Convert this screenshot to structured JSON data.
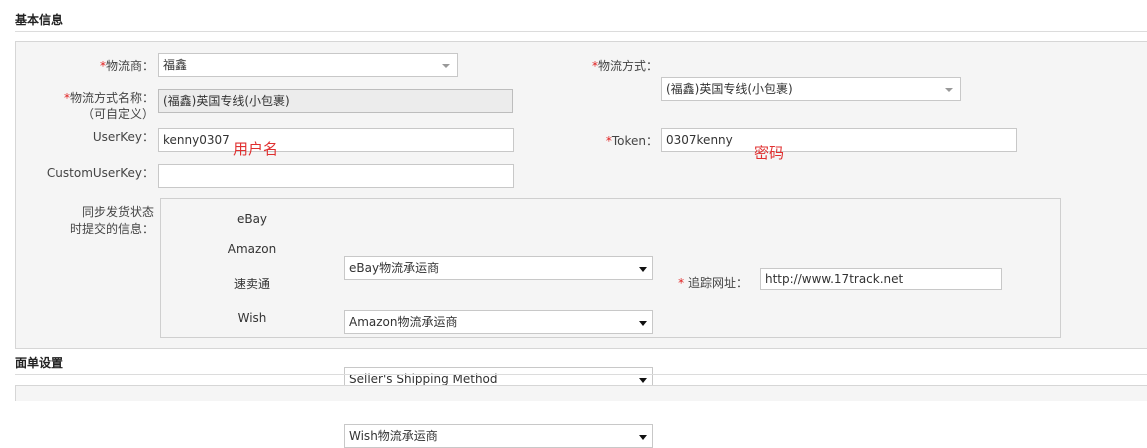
{
  "sections": {
    "basic": {
      "title": "基本信息"
    },
    "label_settings": {
      "title": "面单设置"
    }
  },
  "form": {
    "carrier": {
      "required": "*",
      "label": "物流商：",
      "value": "福鑫"
    },
    "shipping_method": {
      "required": "*",
      "label": "物流方式：",
      "value": "(福鑫)英国专线(小包裹)"
    },
    "method_name": {
      "required": "*",
      "label_line1": "物流方式名称：",
      "label_line2": "（可自定义）",
      "value": "(福鑫)英国专线(小包裹)"
    },
    "userkey": {
      "label": "UserKey：",
      "value": "kenny0307",
      "annotation": "用户名"
    },
    "token": {
      "required": "*",
      "label": "Token：",
      "value": "0307kenny",
      "annotation": "密码"
    },
    "custom_userkey": {
      "label": "CustomUserKey：",
      "value": ""
    }
  },
  "sync": {
    "label_line1": "同步发货状态",
    "label_line2": "时提交的信息：",
    "rows": [
      {
        "platform": "eBay",
        "value": "eBay物流承运商"
      },
      {
        "platform": "Amazon",
        "value": "Amazon物流承运商"
      },
      {
        "platform": "速卖通",
        "value": "Seller's Shipping Method"
      },
      {
        "platform": "Wish",
        "value": "Wish物流承运商"
      }
    ],
    "tracking": {
      "required": "*",
      "label": "追踪网址：",
      "value": "http://www.17track.net"
    }
  },
  "colors": {
    "required": "#e02020",
    "annotation": "#e03030",
    "panel": "#f5f5f5"
  }
}
